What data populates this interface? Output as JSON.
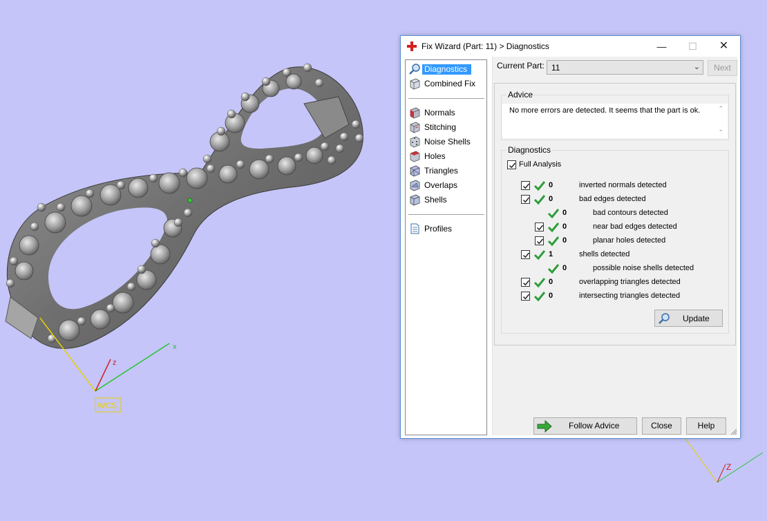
{
  "viewport": {
    "wcs_label": "WCS",
    "axis_x": "x",
    "axis_z": "z",
    "axis_z2": "Z",
    "background": "#c5c5f9"
  },
  "dialog": {
    "title": "Fix Wizard (Part: 11) > Diagnostics",
    "icon": "red-cross-icon",
    "controls": {
      "minimize": "—",
      "maximize": "☐",
      "close": "✕"
    }
  },
  "sidebar": {
    "groups": [
      [
        {
          "label": "Diagnostics",
          "icon": "magnifier-icon",
          "selected": true
        },
        {
          "label": "Combined Fix",
          "icon": "cube-icon"
        }
      ],
      [
        {
          "label": "Normals",
          "icon": "cube-red-icon"
        },
        {
          "label": "Stitching",
          "icon": "cube-stitch-icon"
        },
        {
          "label": "Noise Shells",
          "icon": "dice-icon"
        },
        {
          "label": "Holes",
          "icon": "cube-hole-icon"
        },
        {
          "label": "Triangles",
          "icon": "triangles-icon"
        },
        {
          "label": "Overlaps",
          "icon": "overlaps-icon"
        },
        {
          "label": "Shells",
          "icon": "shells-icon"
        }
      ],
      [
        {
          "label": "Profiles",
          "icon": "document-icon"
        }
      ]
    ]
  },
  "current_part": {
    "label": "Current Part:",
    "value": "11",
    "next_label": "Next"
  },
  "advice": {
    "title": "Advice",
    "text": "No more errors are detected. It seems that the part is ok."
  },
  "diagnostics": {
    "title": "Diagnostics",
    "full_analysis": {
      "label": "Full Analysis",
      "checked": true
    },
    "rows": [
      {
        "checkbox": true,
        "level": 0,
        "count": "0",
        "label": "inverted normals detected"
      },
      {
        "checkbox": true,
        "level": 0,
        "count": "0",
        "label": "bad edges detected"
      },
      {
        "checkbox": false,
        "level": 1,
        "count": "0",
        "label": "bad contours detected"
      },
      {
        "checkbox": true,
        "level": 1,
        "count": "0",
        "label": "near bad edges detected"
      },
      {
        "checkbox": true,
        "level": 1,
        "count": "0",
        "label": "planar holes detected"
      },
      {
        "checkbox": true,
        "level": 0,
        "count": "1",
        "label": "shells detected"
      },
      {
        "checkbox": false,
        "level": 1,
        "count": "0",
        "label": "possible noise shells detected"
      },
      {
        "checkbox": true,
        "level": 0,
        "count": "0",
        "label": "overlapping triangles detected"
      },
      {
        "checkbox": true,
        "level": 0,
        "count": "0",
        "label": "intersecting triangles detected"
      }
    ],
    "update_label": "Update"
  },
  "footer": {
    "follow_advice": "Follow Advice",
    "close": "Close",
    "help": "Help"
  },
  "colors": {
    "accent": "#3399ff",
    "check_green": "#2e9e3a",
    "axis_yellow": "#e8d000",
    "axis_green": "#27c42c",
    "axis_red": "#d02020"
  }
}
